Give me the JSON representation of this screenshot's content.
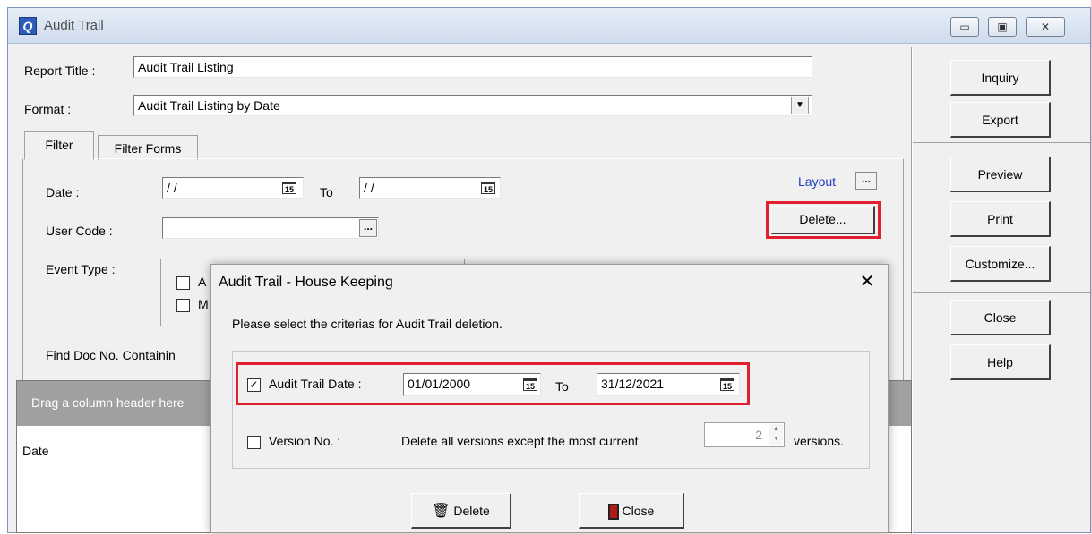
{
  "window": {
    "title": "Audit Trail",
    "controls": {
      "minimize": "▭",
      "maximize": "▣",
      "close": "✕"
    }
  },
  "report": {
    "title_label": "Report Title :",
    "title_value": "Audit Trail Listing",
    "format_label": "Format :",
    "format_value": "Audit Trail Listing by Date"
  },
  "tabs": [
    "Filter",
    "Filter Forms"
  ],
  "filter": {
    "date_label": "Date :",
    "date_from": "/ /",
    "to_label": "To",
    "date_to": "/ /",
    "user_code_label": "User Code :",
    "event_type_label": "Event Type :",
    "event_a_partial": "A",
    "event_m_partial": "M",
    "find_doc_label": "Find Doc No. Containin",
    "layout_label": "Layout",
    "delete_button": "Delete..."
  },
  "grid": {
    "hint": "Drag a column header here",
    "column": "Date"
  },
  "side_buttons": {
    "inquiry": "Inquiry",
    "export": "Export",
    "preview": "Preview",
    "print": "Print",
    "customize": "Customize...",
    "close": "Close",
    "help": "Help"
  },
  "dialog": {
    "title": "Audit Trail - House Keeping",
    "close": "✕",
    "instruction": "Please select the criterias for Audit Trail deletion.",
    "audit_date_label": "Audit Trail Date :",
    "audit_date_checked": true,
    "date_from": "01/01/2000",
    "to_label": "To",
    "date_to": "31/12/2021",
    "version_label": "Version No. :",
    "version_checked": false,
    "version_desc": "Delete all versions except the most current",
    "version_count": "2",
    "versions_suffix": "versions.",
    "delete_button": "Delete",
    "close_button": "Close"
  },
  "colors": {
    "highlight": "#e0202e",
    "link": "#1f3fbf",
    "grid_header": "#a0a0a0"
  },
  "icons": {
    "calendar": "15",
    "dots": "..."
  }
}
